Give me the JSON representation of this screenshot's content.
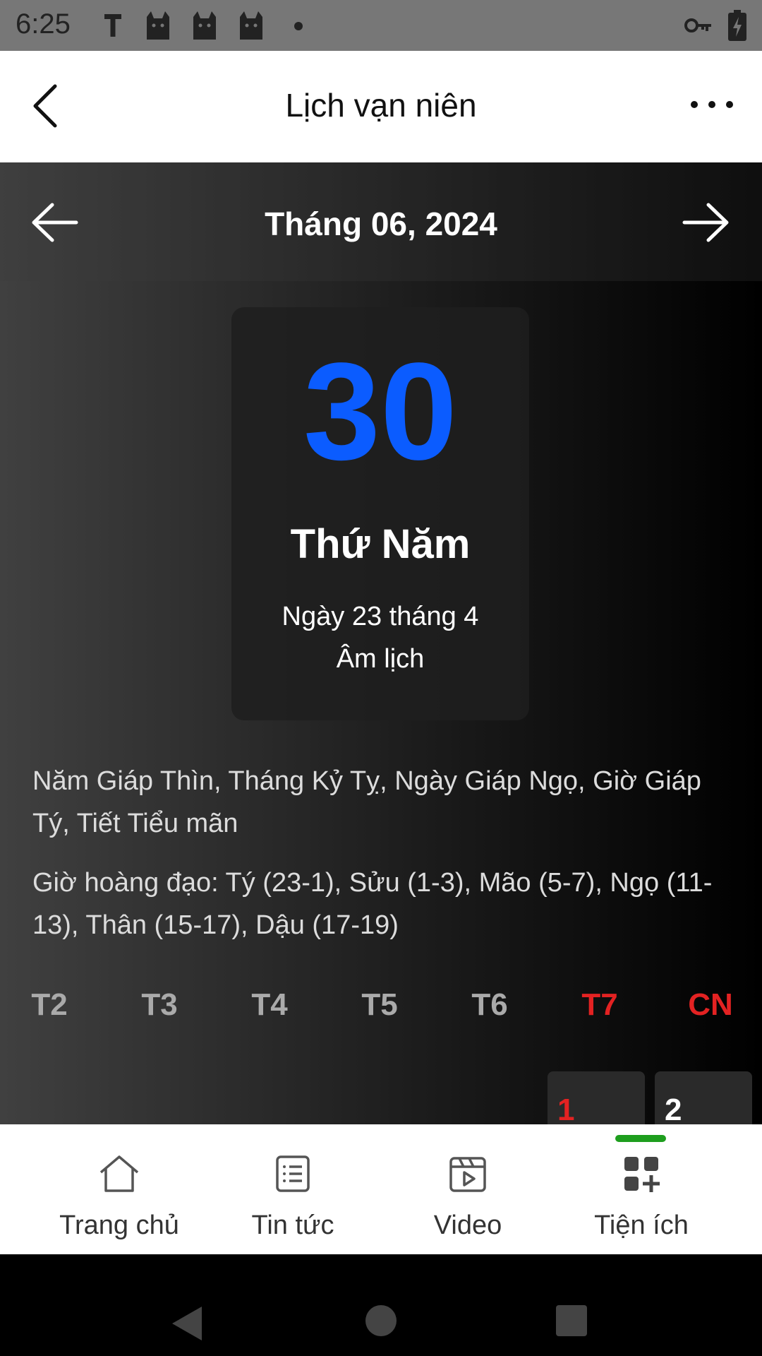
{
  "status_bar": {
    "time": "6:25",
    "icons": [
      "t-icon",
      "cat-icon",
      "cat-icon",
      "cat-icon",
      "dot-icon",
      "vpn-key-icon",
      "battery-charging-icon"
    ]
  },
  "header": {
    "title": "Lịch vạn niên",
    "back_icon": "chevron-left-icon",
    "more_icon": "more-horizontal-icon"
  },
  "calendar": {
    "month_label": "Tháng 06, 2024",
    "selected_day": {
      "number": "30",
      "weekday": "Thứ Năm",
      "lunar_line1": "Ngày 23 tháng 4",
      "lunar_line2": "Âm lịch"
    },
    "can_chi": "Năm Giáp Thìn, Tháng Kỷ Tỵ, Ngày Giáp Ngọ, Giờ Giáp Tý, Tiết Tiểu mãn",
    "hoang_dao": "Giờ hoàng đạo: Tý (23-1), Sửu (1-3), Mão (5-7), Ngọ (11-13), Thân (15-17), Dậu (17-19)",
    "weekdays": [
      "T2",
      "T3",
      "T4",
      "T5",
      "T6",
      "T7",
      "CN"
    ],
    "first_row_days": [
      "1",
      "2"
    ]
  },
  "colors": {
    "day_number": "#0b5cff",
    "weekend": "#e32222",
    "active_tab_indicator": "#1e9e1e"
  },
  "bottom_nav": {
    "items": [
      {
        "label": "Trang chủ",
        "icon": "home-icon"
      },
      {
        "label": "Tin tức",
        "icon": "news-list-icon"
      },
      {
        "label": "Video",
        "icon": "video-icon"
      },
      {
        "label": "Tiện ích",
        "icon": "apps-add-icon"
      }
    ],
    "active": "Tiện ích"
  },
  "system_nav": [
    "back-triangle-icon",
    "home-circle-icon",
    "recents-square-icon"
  ]
}
